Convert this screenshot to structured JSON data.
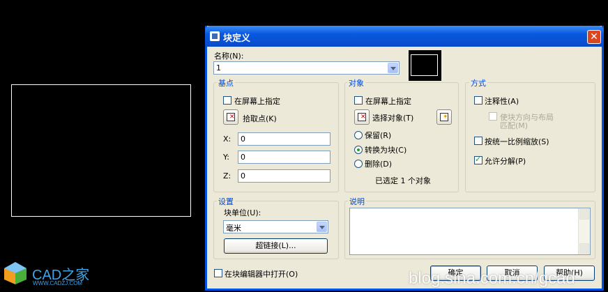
{
  "dialog": {
    "title": "块定义",
    "close_label": "✕"
  },
  "name": {
    "label": "名称(N):",
    "value": "1"
  },
  "base_point": {
    "group_label": "基点",
    "specify_on_screen": "在屏幕上指定",
    "pick_point": "拾取点(K)",
    "x_label": "X:",
    "y_label": "Y:",
    "z_label": "Z:",
    "x_value": "0",
    "y_value": "0",
    "z_value": "0"
  },
  "objects": {
    "group_label": "对象",
    "specify_on_screen": "在屏幕上指定",
    "select_objects": "选择对象(T)",
    "retain": "保留(R)",
    "convert_to_block": "转换为块(C)",
    "delete": "删除(D)",
    "selected_count": "已选定 1 个对象"
  },
  "behavior": {
    "group_label": "方式",
    "annotative": "注释性(A)",
    "match_orientation_line1": "使块方向与布局",
    "match_orientation_line2": "匹配(M)",
    "scale_uniformly": "按统一比例缩放(S)",
    "allow_exploding": "允许分解(P)",
    "annotative_checked": false,
    "scale_uniformly_checked": false,
    "allow_exploding_checked": true
  },
  "settings": {
    "group_label": "设置",
    "block_unit_label": "块单位(U):",
    "block_unit_value": "毫米",
    "hyperlink": "超链接(L)..."
  },
  "description": {
    "group_label": "说明"
  },
  "footer": {
    "open_in_editor": "在块编辑器中打开(O)",
    "ok": "确定",
    "cancel": "取消",
    "help": "帮助(H)"
  },
  "brand": {
    "name": "CAD之家",
    "url": "WWW.CADZJ.COM"
  },
  "watermark": "blog.sina.com.cn/gcad",
  "colors": {
    "titlebar": "#0a4fd2",
    "dialog_bg": "#ece9d8",
    "group_label": "#0046d5",
    "close": "#d9461f",
    "check_mark": "#21a121"
  }
}
